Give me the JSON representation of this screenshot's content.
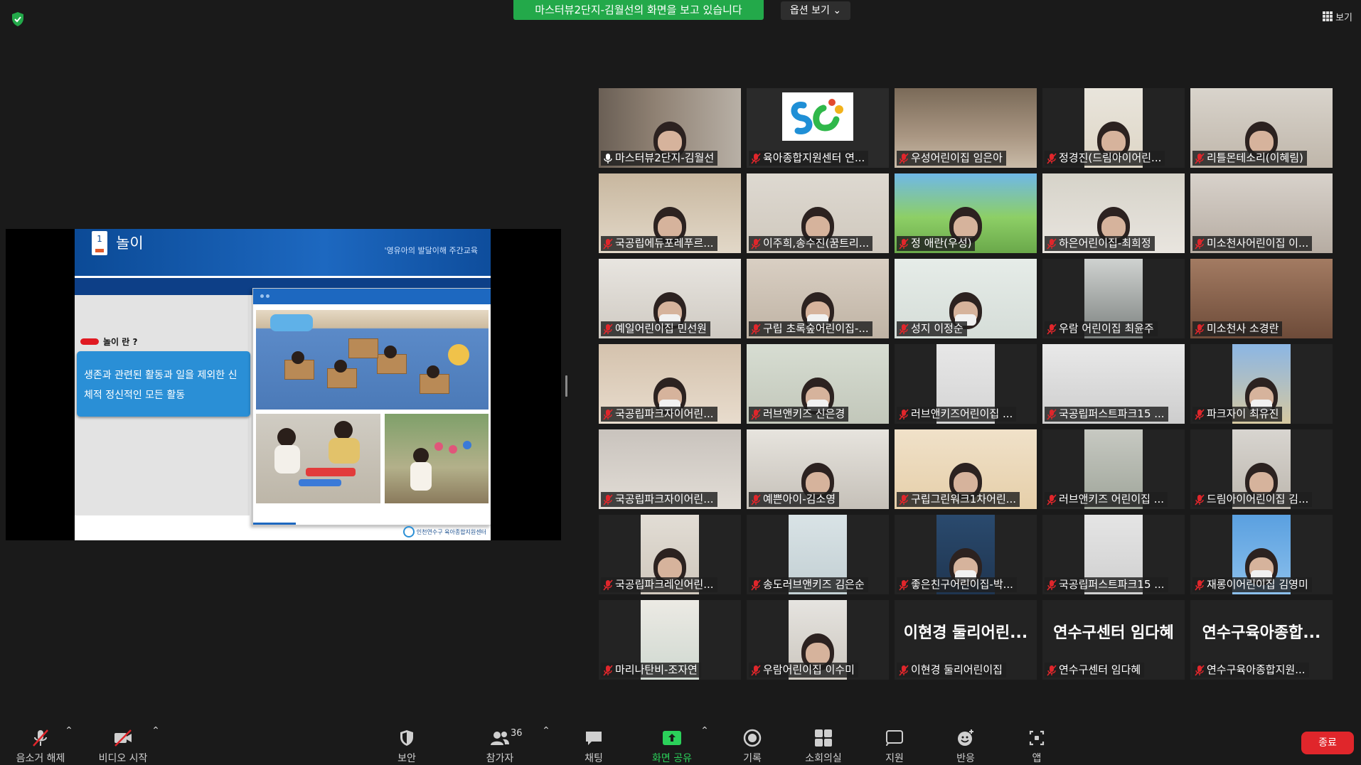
{
  "top": {
    "sharing_banner": "마스터뷰2단지-김월선의 화면을 보고 있습니다",
    "view_options": "옵션 보기",
    "view_label": "보기"
  },
  "slide": {
    "number": "1",
    "title": "놀이",
    "subtitle": "'영유아의 발달이해 주간교육",
    "keyword": "놀이 란 ?",
    "definition": "생존과 관련된 활동과 일을 제외한 신체적 정신적인 모든 활동",
    "logo_text": "인천연수구 육아종합지원센터"
  },
  "participants": [
    {
      "name": "마스터뷰2단지-김월선",
      "muted": false,
      "active": true
    },
    {
      "name": "육아종합지원센터 연..."
    },
    {
      "name": "우성어린이집 임은아"
    },
    {
      "name": "정경진(드림아이어린..."
    },
    {
      "name": "리틀몬테소리(이혜림)"
    },
    {
      "name": "국공립에듀포레푸르..."
    },
    {
      "name": "이주희,송수진(꿈트리..."
    },
    {
      "name": "정 애란(우성)"
    },
    {
      "name": "하은어린이집-최희정"
    },
    {
      "name": "미소천사어린이집 이..."
    },
    {
      "name": "예일어린이집 민선원"
    },
    {
      "name": "구립 초록숲어린이집-..."
    },
    {
      "name": "성지 이정순"
    },
    {
      "name": "우람 어린이집 최윤주"
    },
    {
      "name": "미소천사 소경란"
    },
    {
      "name": "국공립파크자이어린..."
    },
    {
      "name": "러브앤키즈 신은경"
    },
    {
      "name": "러브앤키즈어린이집 ..."
    },
    {
      "name": "국공립퍼스트파크15 ..."
    },
    {
      "name": "파크자이 최유진"
    },
    {
      "name": "국공립파크자이어린..."
    },
    {
      "name": "예쁜아이-김소영"
    },
    {
      "name": "구립그린워크1차어린..."
    },
    {
      "name": "러브앤키즈 어린이집 ..."
    },
    {
      "name": "드림아이어린이집 김..."
    },
    {
      "name": "국공립파크레인어린..."
    },
    {
      "name": "송도러브앤키즈 김은순"
    },
    {
      "name": "좋은친구어린이집-박..."
    },
    {
      "name": "국공립퍼스트파크15 ..."
    },
    {
      "name": "재롱이어린이집 김영미"
    },
    {
      "name": "마리나탄비-조자연"
    },
    {
      "name": "우람어린이집 이수미"
    },
    {
      "name": "이현경 둘리어린이집",
      "display": "이현경 둘리어린..."
    },
    {
      "name": "연수구센터 임다혜",
      "display": "연수구센터 임다혜"
    },
    {
      "name": "연수구육아종합지원...",
      "display": "연수구육아종합..."
    }
  ],
  "toolbar": {
    "mute": "음소거 해제",
    "video": "비디오 시작",
    "security": "보안",
    "participants": "참가자",
    "participants_count": "36",
    "chat": "채팅",
    "share": "화면 공유",
    "record": "기록",
    "breakout": "소회의실",
    "support": "지원",
    "reactions": "반응",
    "apps": "앱",
    "end": "종료"
  },
  "colors": {
    "banner_green": "#23a94a",
    "active_border": "#f2e55c",
    "end_red": "#e0262b",
    "share_green": "#2bd15a",
    "muted_red": "#e0262b"
  }
}
